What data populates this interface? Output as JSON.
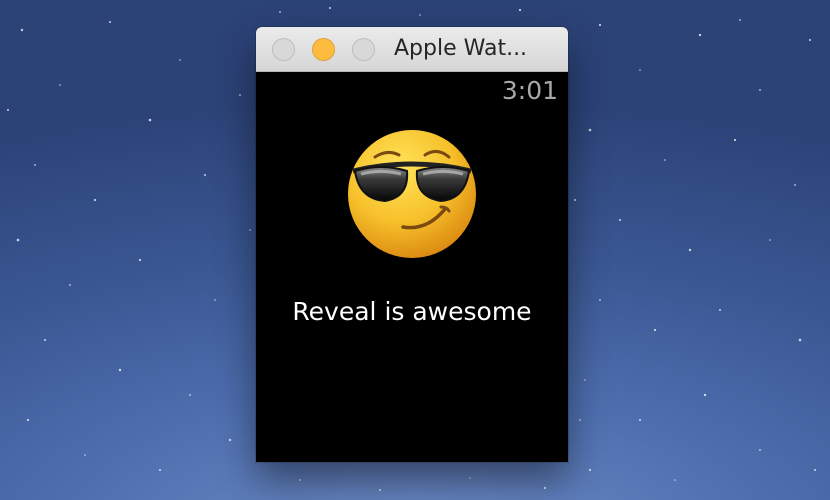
{
  "window": {
    "title": "Apple Wat..."
  },
  "watch": {
    "time": "3:01",
    "emoji_icon": "cool-sunglasses-emoji-icon",
    "message": "Reveal is awesome"
  },
  "colors": {
    "minimize": "#fdbc40",
    "inactive_button": "#d8d8d8",
    "screen_background": "#000000",
    "clock_text": "#a9a9a9",
    "emoji_yellow": "#f7c12b"
  }
}
